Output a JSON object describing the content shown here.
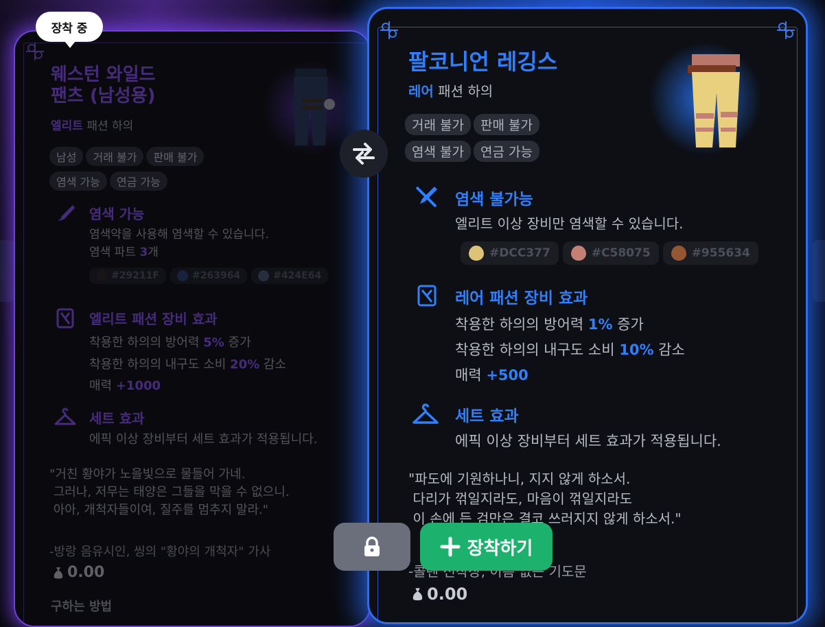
{
  "theme": {
    "purple": "#7a44d8",
    "blue": "#2f80ff",
    "green": "#1db16e"
  },
  "tooltip": {
    "label": "장착 중"
  },
  "left_card": {
    "title_line1": "웨스턴 와일드",
    "title_line2": "팬츠 (남성용)",
    "rarity": "엘리트",
    "category": "패션 하의",
    "tags": [
      "남성",
      "거래 불가",
      "판매 불가",
      "염색 가능",
      "연금 가능"
    ],
    "dye": {
      "title": "염색 가능",
      "desc": "염색약을 사용해 염색할 수 있습니다.",
      "parts_label": "염색 파트",
      "parts_count": "3",
      "parts_unit": "개",
      "swatches": [
        {
          "hex": "#29211F",
          "color": "#29211f"
        },
        {
          "hex": "#263964",
          "color": "#263964"
        },
        {
          "hex": "#424E64",
          "color": "#424e64"
        }
      ]
    },
    "effect": {
      "title": "엘리트 패션 장비 효과",
      "line1_pre": "착용한 하의의 방어력 ",
      "line1_val": "5%",
      "line1_post": " 증가",
      "line2_pre": "착용한 하의의 내구도 소비 ",
      "line2_val": "20%",
      "line2_post": " 감소",
      "line3_pre": "매력 ",
      "line3_val": "+1000"
    },
    "set": {
      "title": "세트 효과",
      "desc": "에픽 이상 장비부터 세트 효과가 적용됩니다."
    },
    "quote": "\"거친 황야가 노을빛으로 물들어 가네.\n 그러나, 저무는 태양은 그들을 막을 수 없으니.\n 아아, 개척자들이여, 질주를 멈추지 말라.\"",
    "quote_source": "-방랑 음유시인, 씽의 \"황야의 개척자\" 가사",
    "price": "0.00",
    "obtain": "구하는 방법"
  },
  "right_card": {
    "title": "팔코니언 레깅스",
    "rarity": "레어",
    "category": "패션 하의",
    "tags": [
      "거래 불가",
      "판매 불가",
      "염색 불가",
      "연금 가능"
    ],
    "dye": {
      "title": "염색 불가능",
      "desc": "엘리트 이상 장비만 염색할 수 있습니다.",
      "swatches": [
        {
          "hex": "#DCC377",
          "color": "#dcc377"
        },
        {
          "hex": "#C58075",
          "color": "#c58075"
        },
        {
          "hex": "#955634",
          "color": "#955634"
        }
      ]
    },
    "effect": {
      "title": "레어 패션 장비 효과",
      "line1_pre": "착용한 하의의 방어력 ",
      "line1_val": "1%",
      "line1_post": " 증가",
      "line2_pre": "착용한 하의의 내구도 소비 ",
      "line2_val": "10%",
      "line2_post": " 감소",
      "line3_pre": "매력 ",
      "line3_val": "+500"
    },
    "set": {
      "title": "세트 효과",
      "desc": "에픽 이상 장비부터 세트 효과가 적용됩니다."
    },
    "quote": "\"파도에 기원하나니, 지지 않게 하소서.\n 다리가 꺾일지라도, 마음이 꺾일지라도\n 이 손에 든 검만은 결코 쓰러지지 않게 하소서.\"",
    "quote_source": "-콜렌 선착장, 이름 없는 기도문",
    "price": "0.00"
  },
  "buttons": {
    "equip_label": "장착하기"
  }
}
